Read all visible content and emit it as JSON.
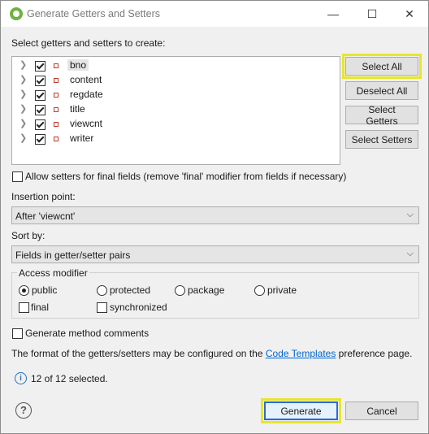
{
  "window": {
    "title": "Generate Getters and Setters",
    "minimize_glyph": "—",
    "maximize_glyph": "☐",
    "close_glyph": "✕"
  },
  "select_label": "Select getters and setters to create:",
  "fields": [
    {
      "name": "bno",
      "checked": true
    },
    {
      "name": "content",
      "checked": true
    },
    {
      "name": "regdate",
      "checked": true
    },
    {
      "name": "title",
      "checked": true
    },
    {
      "name": "viewcnt",
      "checked": true
    },
    {
      "name": "writer",
      "checked": true
    }
  ],
  "side_buttons": {
    "select_all": "Select All",
    "deselect_all": "Deselect All",
    "select_getters": "Select Getters",
    "select_setters": "Select Setters"
  },
  "allow_final_setters": {
    "label": "Allow setters for final fields (remove 'final' modifier from fields if necessary)",
    "checked": false
  },
  "insertion_point": {
    "label": "Insertion point:",
    "value": "After 'viewcnt'"
  },
  "sort_by": {
    "label": "Sort by:",
    "value": "Fields in getter/setter pairs"
  },
  "access_modifier": {
    "title": "Access modifier",
    "options": [
      "public",
      "protected",
      "package",
      "private"
    ],
    "selected": "public",
    "final_label": "final",
    "synchronized_label": "synchronized"
  },
  "generate_comments": {
    "label": "Generate method comments",
    "checked": false
  },
  "format_note": {
    "before": "The format of the getters/setters may be configured on the ",
    "link": "Code Templates",
    "after": " preference page."
  },
  "status": "12 of 12 selected.",
  "footer": {
    "help_glyph": "?",
    "generate": "Generate",
    "cancel": "Cancel"
  },
  "colors": {
    "highlight_outline": "#e6e62e",
    "link": "#0066cc",
    "field_icon": "#c0392b",
    "default_button_border": "#2a6ad6"
  }
}
